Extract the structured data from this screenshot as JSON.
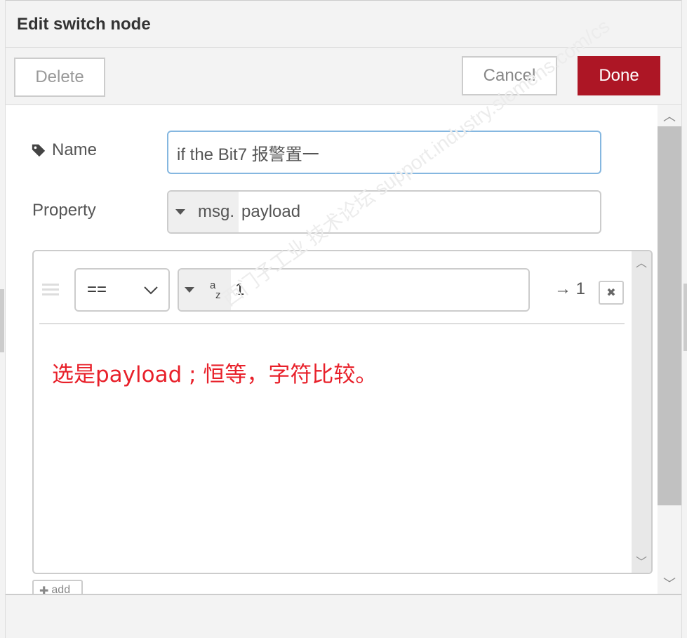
{
  "dialog": {
    "title": "Edit switch node"
  },
  "toolbar": {
    "delete_label": "Delete",
    "cancel_label": "Cancel",
    "done_label": "Done"
  },
  "form": {
    "name_label": "Name",
    "name_value": "if the Bit7 报警置一",
    "property_label": "Property",
    "property_type": "msg.",
    "property_value": "payload"
  },
  "rules": [
    {
      "operator": "==",
      "value_type_icon": "az-string-icon",
      "value": "1",
      "output": "→ 1"
    }
  ],
  "annotation": "选是payload ; 恒等，字符比较。",
  "add_label": "add",
  "watermark": "西门子工业 技术论坛 support.industry.siemens.com/cs",
  "colors": {
    "done": "#ad1625",
    "focus_border": "#85b7e0",
    "annotation": "#e8202a"
  }
}
